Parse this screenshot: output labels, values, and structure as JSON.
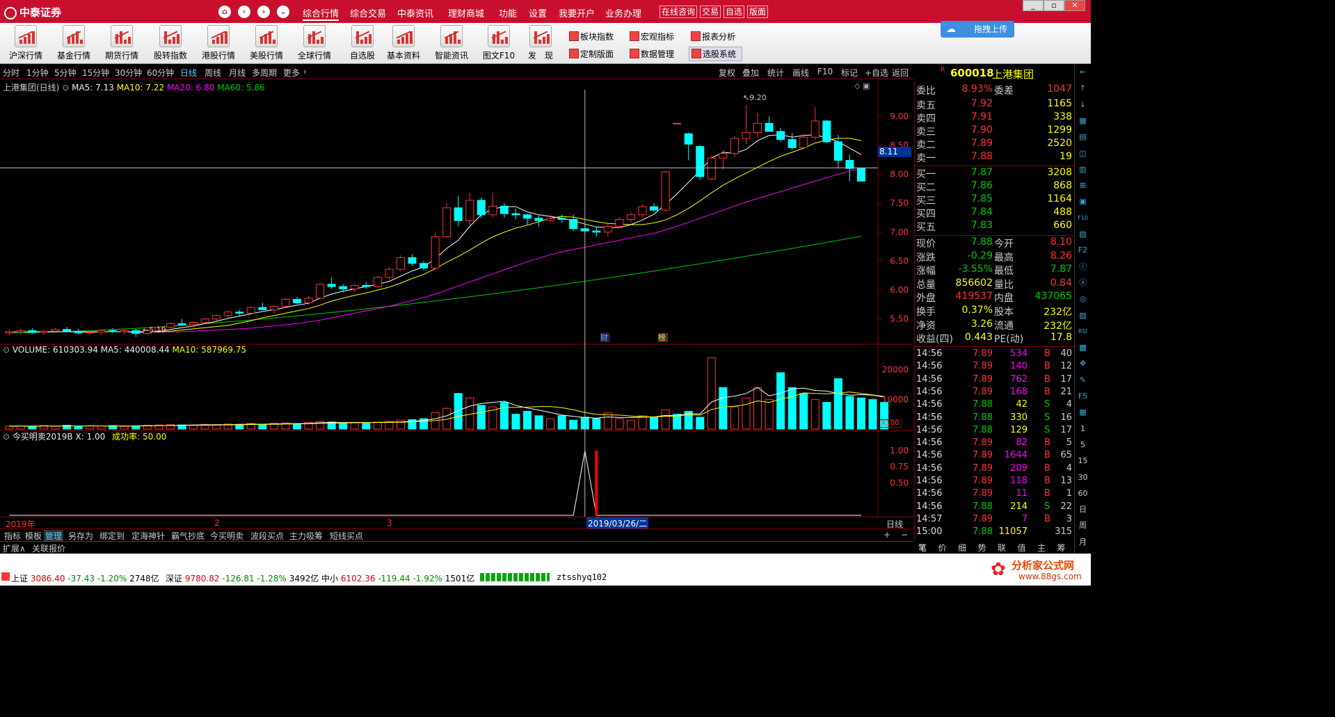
{
  "app": {
    "logo": "中泰证券",
    "menus": [
      "综合行情",
      "综合交易",
      "中泰资讯",
      "理财商城",
      "功能",
      "设置",
      "我要开户",
      "业务办理"
    ],
    "box_buttons": [
      "在线咨询",
      "交易",
      "自选",
      "版面"
    ],
    "window": [
      "_",
      "▫",
      "✕"
    ]
  },
  "toolbar": {
    "buttons": [
      "沪深行情",
      "基金行情",
      "期货行情",
      "股转指数",
      "港股行情",
      "美股行情",
      "全球行情",
      "自选股",
      "基本资料",
      "智能资讯",
      "图文F10",
      "发　现"
    ],
    "small": [
      "板块指数",
      "宏观指标",
      "报表分析",
      "定制版面",
      "数据管理",
      "选股系统"
    ],
    "upload": "拖拽上传"
  },
  "periods": {
    "items": [
      "分时",
      "1分钟",
      "5分钟",
      "15分钟",
      "30分钟",
      "60分钟",
      "日线",
      "周线",
      "月线",
      "多周期",
      "更多"
    ],
    "active": "日线"
  },
  "chart_tools": [
    "复权",
    "叠加",
    "统计",
    "画线",
    "F10",
    "标记",
    "+自选",
    "返回"
  ],
  "stock": {
    "code": "600018",
    "name": "上港集团",
    "badge": "R"
  },
  "main_chart": {
    "title": "上港集团(日线)",
    "ma5": "MA5: 7.13",
    "ma10": "MA10: 7.22",
    "ma20": "MA20: 6.80",
    "ma60": "MA60: 5.86",
    "high_label": "9.20",
    "low_label": "5.19",
    "cursor_price": "8.11",
    "markers": [
      "财",
      "榜"
    ]
  },
  "vol_chart": {
    "title": "VOLUME: 610303.94",
    "ma5": "MA5: 440008.44",
    "ma10": "MA10: 587969.75",
    "unit": "X100"
  },
  "ind_chart": {
    "title": "今买明卖2019B",
    "x": "X: 1.00",
    "rate": "成功率: 50.00"
  },
  "timeline": {
    "year": "2019年",
    "m2": "2",
    "m3": "3",
    "cursor_date": "2019/03/26/二",
    "period": "日线"
  },
  "chart_data": [
    {
      "type": "candlestick",
      "title": "上港集团(日线)",
      "ohlc": [
        [
          5.26,
          5.32,
          5.22,
          5.28
        ],
        [
          5.28,
          5.33,
          5.24,
          5.3
        ],
        [
          5.3,
          5.34,
          5.25,
          5.27
        ],
        [
          5.27,
          5.31,
          5.22,
          5.29
        ],
        [
          5.29,
          5.35,
          5.26,
          5.32
        ],
        [
          5.32,
          5.36,
          5.27,
          5.29
        ],
        [
          5.29,
          5.33,
          5.24,
          5.26
        ],
        [
          5.26,
          5.3,
          5.22,
          5.27
        ],
        [
          5.27,
          5.32,
          5.23,
          5.3
        ],
        [
          5.3,
          5.34,
          5.26,
          5.28
        ],
        [
          5.28,
          5.32,
          5.24,
          5.3
        ],
        [
          5.3,
          5.33,
          5.19,
          5.25
        ],
        [
          5.25,
          5.32,
          5.22,
          5.3
        ],
        [
          5.3,
          5.38,
          5.28,
          5.36
        ],
        [
          5.36,
          5.45,
          5.34,
          5.42
        ],
        [
          5.42,
          5.5,
          5.38,
          5.4
        ],
        [
          5.4,
          5.46,
          5.36,
          5.44
        ],
        [
          5.44,
          5.52,
          5.42,
          5.5
        ],
        [
          5.5,
          5.58,
          5.46,
          5.56
        ],
        [
          5.56,
          5.64,
          5.52,
          5.62
        ],
        [
          5.62,
          5.66,
          5.56,
          5.6
        ],
        [
          5.6,
          5.72,
          5.58,
          5.7
        ],
        [
          5.7,
          5.78,
          5.66,
          5.66
        ],
        [
          5.66,
          5.74,
          5.6,
          5.72
        ],
        [
          5.72,
          5.86,
          5.7,
          5.84
        ],
        [
          5.84,
          5.88,
          5.76,
          5.78
        ],
        [
          5.78,
          5.9,
          5.74,
          5.86
        ],
        [
          5.86,
          6.12,
          5.84,
          6.1
        ],
        [
          6.1,
          6.22,
          6.02,
          6.06
        ],
        [
          6.06,
          6.1,
          5.96,
          6.02
        ],
        [
          6.02,
          6.1,
          5.96,
          6.08
        ],
        [
          6.08,
          6.14,
          6.02,
          6.06
        ],
        [
          6.06,
          6.24,
          6.04,
          6.22
        ],
        [
          6.22,
          6.4,
          6.18,
          6.36
        ],
        [
          6.36,
          6.6,
          6.32,
          6.56
        ],
        [
          6.56,
          6.62,
          6.42,
          6.46
        ],
        [
          6.46,
          6.5,
          6.34,
          6.38
        ],
        [
          6.38,
          7.0,
          6.36,
          6.92
        ],
        [
          6.92,
          7.5,
          6.9,
          7.42
        ],
        [
          7.42,
          7.62,
          7.1,
          7.2
        ],
        [
          7.2,
          7.68,
          7.12,
          7.55
        ],
        [
          7.55,
          7.6,
          7.24,
          7.3
        ],
        [
          7.3,
          7.68,
          7.26,
          7.45
        ],
        [
          7.45,
          7.5,
          7.25,
          7.32
        ],
        [
          7.32,
          7.4,
          7.22,
          7.3
        ],
        [
          7.3,
          7.32,
          7.12,
          7.24
        ],
        [
          7.24,
          7.3,
          7.1,
          7.2
        ],
        [
          7.2,
          7.3,
          7.16,
          7.24
        ],
        [
          7.24,
          7.3,
          7.16,
          7.22
        ],
        [
          7.22,
          7.3,
          7.02,
          7.06
        ],
        [
          7.06,
          7.12,
          6.98,
          7.02
        ],
        [
          7.02,
          7.1,
          6.92,
          7.0
        ],
        [
          7.0,
          7.14,
          6.92,
          7.1
        ],
        [
          7.1,
          7.26,
          7.06,
          7.22
        ],
        [
          7.22,
          7.34,
          7.16,
          7.3
        ],
        [
          7.3,
          7.48,
          7.26,
          7.44
        ],
        [
          7.44,
          7.5,
          7.36,
          7.38
        ],
        [
          7.38,
          8.06,
          7.36,
          8.04
        ],
        [
          8.88,
          8.88,
          8.88,
          8.88
        ],
        [
          8.7,
          8.72,
          8.24,
          8.52
        ],
        [
          8.48,
          8.5,
          7.9,
          7.96
        ],
        [
          7.92,
          8.32,
          7.9,
          8.28
        ],
        [
          8.28,
          8.42,
          8.08,
          8.36
        ],
        [
          8.36,
          8.66,
          8.3,
          8.62
        ],
        [
          8.62,
          9.2,
          8.52,
          8.72
        ],
        [
          8.72,
          9.06,
          8.62,
          8.88
        ],
        [
          8.88,
          9.0,
          8.74,
          8.74
        ],
        [
          8.74,
          8.8,
          8.56,
          8.6
        ],
        [
          8.6,
          8.72,
          8.42,
          8.46
        ],
        [
          8.46,
          8.7,
          8.44,
          8.64
        ],
        [
          8.64,
          9.16,
          8.6,
          8.92
        ],
        [
          8.92,
          8.94,
          8.54,
          8.56
        ],
        [
          8.56,
          8.68,
          8.1,
          8.24
        ],
        [
          8.24,
          8.34,
          7.88,
          8.1
        ],
        [
          8.1,
          8.12,
          7.88,
          7.88
        ]
      ],
      "ma5": [
        5.28,
        5.28,
        5.28,
        5.28,
        5.28,
        5.28,
        5.28,
        5.27,
        5.28,
        5.28,
        5.28,
        5.27,
        5.27,
        5.29,
        5.32,
        5.35,
        5.38,
        5.42,
        5.46,
        5.51,
        5.55,
        5.59,
        5.63,
        5.66,
        5.7,
        5.74,
        5.77,
        5.86,
        5.93,
        5.98,
        6.02,
        6.06,
        6.1,
        6.15,
        6.24,
        6.33,
        6.4,
        6.54,
        6.72,
        6.86,
        7.1,
        7.3,
        7.4,
        7.44,
        7.44,
        7.35,
        7.3,
        7.27,
        7.24,
        7.2,
        7.14,
        7.09,
        7.08,
        7.08,
        7.13,
        7.21,
        7.31,
        7.48,
        7.66,
        7.86,
        8.06,
        8.28,
        8.38,
        8.36,
        8.43,
        8.58,
        8.67,
        8.68,
        8.64,
        8.67,
        8.68,
        8.63,
        8.56,
        8.45,
        8.34
      ],
      "ma10": [
        5.28,
        5.28,
        5.28,
        5.28,
        5.28,
        5.28,
        5.28,
        5.28,
        5.28,
        5.28,
        5.28,
        5.28,
        5.28,
        5.28,
        5.29,
        5.31,
        5.33,
        5.35,
        5.37,
        5.39,
        5.43,
        5.47,
        5.52,
        5.56,
        5.6,
        5.64,
        5.68,
        5.74,
        5.81,
        5.86,
        5.91,
        5.95,
        6.0,
        6.05,
        6.12,
        6.2,
        6.27,
        6.37,
        6.48,
        6.58,
        6.69,
        6.81,
        6.92,
        7.0,
        7.07,
        7.12,
        7.18,
        7.24,
        7.27,
        7.26,
        7.22,
        7.18,
        7.15,
        7.14,
        7.13,
        7.13,
        7.16,
        7.21,
        7.3,
        7.41,
        7.54,
        7.68,
        7.81,
        7.92,
        8.02,
        8.12,
        8.22,
        8.31,
        8.38,
        8.45,
        8.54,
        8.59,
        8.62,
        8.62,
        8.58
      ],
      "ma20": [
        5.28,
        5.28,
        5.28,
        5.28,
        5.28,
        5.28,
        5.28,
        5.28,
        5.28,
        5.28,
        5.28,
        5.28,
        5.28,
        5.28,
        5.28,
        5.28,
        5.29,
        5.3,
        5.31,
        5.32,
        5.33,
        5.34,
        5.36,
        5.38,
        5.4,
        5.42,
        5.45,
        5.48,
        5.52,
        5.56,
        5.6,
        5.64,
        5.68,
        5.72,
        5.77,
        5.82,
        5.87,
        5.93,
        6.0,
        6.07,
        6.14,
        6.21,
        6.28,
        6.35,
        6.42,
        6.49,
        6.55,
        6.61,
        6.66,
        6.7,
        6.74,
        6.78,
        6.82,
        6.86,
        6.9,
        6.94,
        6.98,
        7.04,
        7.1,
        7.17,
        7.24,
        7.31,
        7.38,
        7.45,
        7.52,
        7.58,
        7.64,
        7.7,
        7.76,
        7.82,
        7.88,
        7.94,
        8.0,
        8.06,
        8.1
      ],
      "ma60_start": 5.26,
      "ma60_end": 6.93,
      "ylim": [
        5.1,
        9.4
      ],
      "yticks": [
        "9.00",
        "8.50",
        "8.00",
        "7.50",
        "7.00",
        "6.50",
        "6.00",
        "5.50"
      ]
    },
    {
      "type": "bar",
      "title": "VOLUME",
      "values": [
        1000,
        1100,
        900,
        1200,
        1000,
        1300,
        900,
        1100,
        1000,
        1200,
        900,
        1100,
        1300,
        1400,
        1500,
        1400,
        1300,
        1600,
        1500,
        1700,
        1600,
        1900,
        1500,
        2000,
        2100,
        1800,
        2200,
        2600,
        2400,
        2000,
        2100,
        1900,
        2300,
        2600,
        3000,
        3200,
        3500,
        5500,
        7000,
        12000,
        10500,
        8000,
        7500,
        9000,
        5000,
        6000,
        4500,
        3500,
        4500,
        3000,
        4000,
        3500,
        5500,
        3500,
        3000,
        4500,
        4000,
        6500,
        5000,
        6000,
        4000,
        24000,
        14000,
        7500,
        10500,
        14000,
        10000,
        19000,
        14000,
        12000,
        10000,
        9000,
        17000,
        11000,
        10500,
        10000,
        9000
      ],
      "up": [
        1,
        1,
        0,
        1,
        1,
        0,
        0,
        1,
        1,
        0,
        1,
        0,
        1,
        1,
        1,
        0,
        1,
        1,
        1,
        1,
        0,
        1,
        0,
        1,
        1,
        0,
        1,
        1,
        0,
        0,
        1,
        0,
        1,
        1,
        1,
        0,
        0,
        1,
        1,
        0,
        1,
        0,
        1,
        0,
        0,
        0,
        0,
        1,
        0,
        0,
        0,
        0,
        1,
        1,
        1,
        1,
        0,
        1,
        0,
        0,
        0,
        1,
        0,
        1,
        1,
        1,
        1,
        0,
        0,
        0,
        1,
        0,
        0,
        0,
        0,
        0,
        0
      ],
      "ma5": [
        1000,
        1050,
        1000,
        1050,
        1040,
        1100,
        1060,
        1100,
        1060,
        1040,
        1040,
        1060,
        1100,
        1180,
        1240,
        1300,
        1380,
        1440,
        1460,
        1500,
        1540,
        1660,
        1640,
        1740,
        1820,
        1860,
        1920,
        2140,
        2220,
        2200,
        2260,
        2200,
        2280,
        2320,
        2380,
        2640,
        2920,
        3480,
        4440,
        6240,
        7740,
        8600,
        9000,
        9400,
        8000,
        7100,
        6400,
        5600,
        4700,
        4300,
        3900,
        3700,
        4100,
        3900,
        3900,
        4000,
        4100,
        4600,
        4600,
        5200,
        5100,
        9100,
        10600,
        11100,
        12000,
        14000,
        11200,
        12100,
        13500,
        13800,
        13000,
        12800,
        12000,
        11400,
        11600,
        11400,
        10800
      ],
      "ma10": [
        1000,
        1030,
        1010,
        1040,
        1030,
        1060,
        1050,
        1060,
        1050,
        1040,
        1040,
        1060,
        1090,
        1140,
        1190,
        1230,
        1260,
        1310,
        1350,
        1400,
        1440,
        1520,
        1560,
        1620,
        1680,
        1740,
        1800,
        1920,
        2000,
        2060,
        2120,
        2160,
        2220,
        2260,
        2300,
        2460,
        2620,
        2860,
        3300,
        4240,
        5000,
        5720,
        6400,
        7300,
        7300,
        7400,
        7600,
        7600,
        7200,
        6500,
        5600,
        5000,
        4800,
        4700,
        4400,
        4200,
        4100,
        4300,
        4400,
        4800,
        4700,
        6600,
        7400,
        7700,
        8300,
        9500,
        9000,
        10100,
        10900,
        12200,
        12000,
        11900,
        12100,
        12500,
        12000,
        11500,
        11000
      ],
      "ylim": [
        0,
        26000
      ],
      "yticks": [
        "20000",
        "10000"
      ]
    },
    {
      "type": "line",
      "title": "今买明卖2019B",
      "values_at_index": {
        "49": 0,
        "50": 1.0,
        "51": 0
      },
      "signal_index": 51,
      "ylim": [
        0,
        1.15
      ],
      "yticks": [
        "1.00",
        "0.75",
        "0.50"
      ]
    }
  ],
  "orderbook": {
    "wb": {
      "l1": "委比",
      "v1": "8.93%",
      "l2": "委差",
      "v2": "1047"
    },
    "sell": [
      [
        "卖五",
        "7.92",
        "1165"
      ],
      [
        "卖四",
        "7.91",
        "338"
      ],
      [
        "卖三",
        "7.90",
        "1299"
      ],
      [
        "卖二",
        "7.89",
        "2520"
      ],
      [
        "卖一",
        "7.88",
        "19"
      ]
    ],
    "buy": [
      [
        "买一",
        "7.87",
        "3208"
      ],
      [
        "买二",
        "7.86",
        "868"
      ],
      [
        "买三",
        "7.85",
        "1164"
      ],
      [
        "买四",
        "7.84",
        "488"
      ],
      [
        "买五",
        "7.83",
        "660"
      ]
    ]
  },
  "quote": [
    [
      "现价",
      "7.88",
      "今开",
      "8.10"
    ],
    [
      "涨跌",
      "-0.29",
      "最高",
      "8.26"
    ],
    [
      "涨幅",
      "-3.55%",
      "最低",
      "7.87"
    ],
    [
      "总量",
      "856602",
      "量比",
      "0.84"
    ],
    [
      "外盘",
      "419537",
      "内盘",
      "437065"
    ],
    [
      "换手",
      "0.37%",
      "股本",
      "232亿"
    ],
    [
      "净资",
      "3.26",
      "流通",
      "232亿"
    ],
    [
      "收益(四)",
      "0.443",
      "PE(动)",
      "17.8"
    ]
  ],
  "ticks": [
    [
      "14:56",
      "7.89",
      "534",
      "B",
      "40"
    ],
    [
      "14:56",
      "7.89",
      "140",
      "B",
      "12"
    ],
    [
      "14:56",
      "7.89",
      "762",
      "B",
      "17"
    ],
    [
      "14:56",
      "7.89",
      "168",
      "B",
      "21"
    ],
    [
      "14:56",
      "7.88",
      "42",
      "S",
      "4"
    ],
    [
      "14:56",
      "7.88",
      "330",
      "S",
      "16"
    ],
    [
      "14:56",
      "7.88",
      "129",
      "S",
      "17"
    ],
    [
      "14:56",
      "7.89",
      "82",
      "B",
      "5"
    ],
    [
      "14:56",
      "7.89",
      "1644",
      "B",
      "65"
    ],
    [
      "14:56",
      "7.89",
      "209",
      "B",
      "4"
    ],
    [
      "14:56",
      "7.89",
      "118",
      "B",
      "13"
    ],
    [
      "14:56",
      "7.89",
      "11",
      "B",
      "1"
    ],
    [
      "14:56",
      "7.88",
      "214",
      "S",
      "22"
    ],
    [
      "14:57",
      "7.89",
      "7",
      "B",
      "3"
    ],
    [
      "15:00",
      "7.88",
      "11057",
      "",
      "315"
    ]
  ],
  "bottom_tabs": [
    "指标",
    "模板",
    "管理",
    "另存为",
    "绑定到",
    "定海神针",
    "霸气抄底",
    "今买明卖",
    "波段买点",
    "主力吸筹",
    "短线买点"
  ],
  "bottom_right": [
    "+",
    "−"
  ],
  "ext": [
    "扩展∧",
    "关联报价"
  ],
  "right_tabs": [
    "笔",
    "价",
    "细",
    "势",
    "联",
    "值",
    "主",
    "筹"
  ],
  "status": {
    "sh_label": "上证",
    "sh": "3086.40",
    "sh_chg": "-37.43",
    "sh_pct": "-1.20%",
    "sh_amt": "2748亿",
    "sz_label": "深证",
    "sz": "9780.82",
    "sz_chg": "-126.81",
    "sz_pct": "-1.28%",
    "sz_amt": "3492亿",
    "zx_label": "中小",
    "zx": "6102.36",
    "zx_chg": "-119.44",
    "zx_pct": "-1.92%",
    "zx_amt": "1501亿",
    "user": "ztsshyq102",
    "watermark1": "分析家公式网",
    "watermark2": "www.88gs.com"
  },
  "sidebar": [
    "←",
    "↑",
    "↓",
    "▦",
    "▤",
    "◫",
    "▥",
    "⊞",
    "▣",
    "F10",
    "▧",
    "F2",
    "ⓘ",
    "ⓐ",
    "◎",
    "▨",
    "RSI",
    "▩",
    "✥",
    "✎",
    "F5",
    "▦",
    "1",
    "5",
    "15",
    "30",
    "60",
    "日",
    "周",
    "月"
  ],
  "colors": {
    "up": "#ff3333",
    "down": "#00ffff",
    "ma5": "#ffffff",
    "ma10": "#ffff00",
    "ma20": "#ff00ff",
    "ma60": "#00cc00",
    "border": "#880000",
    "title_bg": "#c8102e"
  }
}
